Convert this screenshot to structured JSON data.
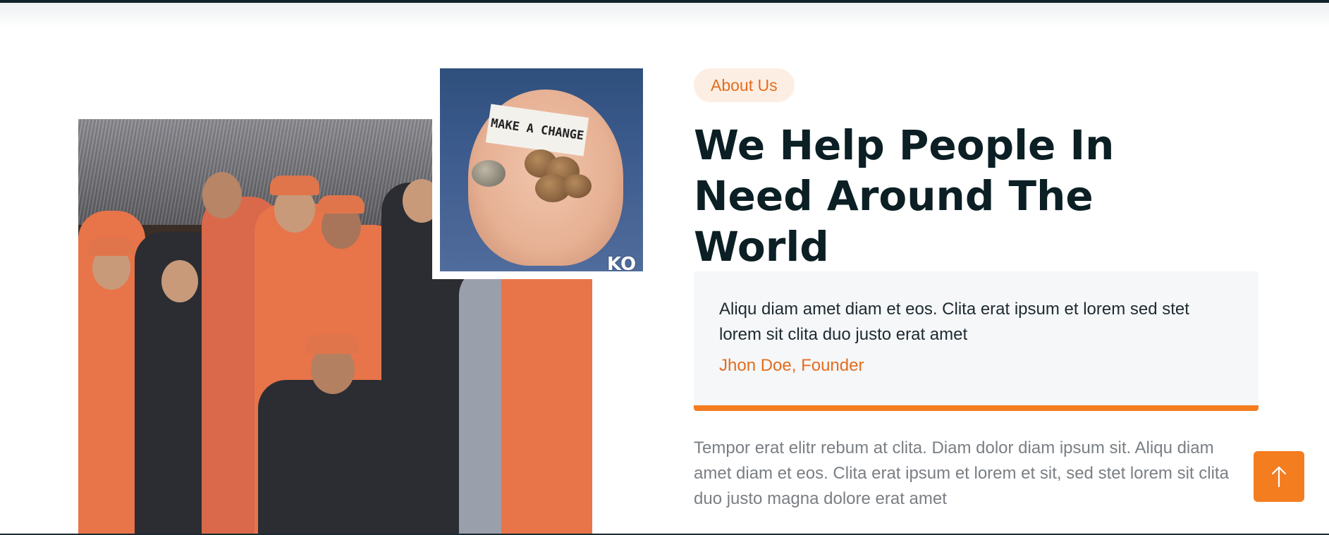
{
  "about": {
    "badge": "About Us",
    "title": "We Help People In Need Around The World",
    "quote": {
      "text": "Aliqu diam amet diam et eos. Clita erat ipsum et lorem sed stet lorem sit clita duo justo erat amet",
      "author": "Jhon Doe, Founder"
    },
    "body": "Tempor erat elitr rebum at clita. Diam dolor diam ipsum sit. Aliqu diam amet diam et eos. Clita erat ipsum et lorem et sit, sed stet lorem sit clita duo justo magna dolore erat amet"
  },
  "images": {
    "small_photo_note": "MAKE A CHANGE",
    "watermark": "KO"
  },
  "colors": {
    "accent": "#f47d20",
    "accent_text": "#e26d1f",
    "heading": "#0b1f24",
    "badge_bg": "#fdeee3",
    "quote_bg": "#f6f7f9"
  },
  "icons": {
    "back_to_top": "arrow-up-icon"
  }
}
